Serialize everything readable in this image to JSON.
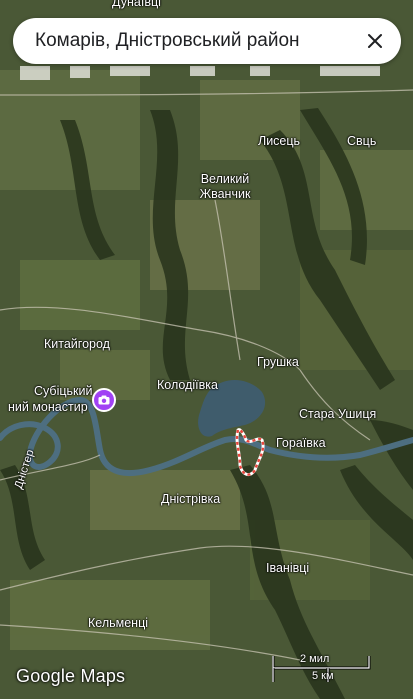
{
  "search": {
    "query": "Комарів, Дністровський район"
  },
  "icons": {
    "close": "close-icon",
    "pin": "camera-pin-icon"
  },
  "colors": {
    "river": "#4d6e80",
    "pin": "#a142f4",
    "boundary": "#e8453c"
  },
  "labels": {
    "dunaivtsi": "Дунаївці",
    "lysets": "Лисець",
    "svts": "Свць",
    "velykyi_zhvanchyk": "Великий Жванчик",
    "kytaihorod": "Китайгород",
    "hrushka": "Грушка",
    "kolodiivka": "Колодіївка",
    "subitskyi": "Субіцький",
    "monastyr": "ний монастир",
    "stara_ushytsia": "Стара Ушиця",
    "horaivka": "Гораївка",
    "dnister": "Дністер",
    "dnistrivka": "Дністрівка",
    "ivanivtsi": "Іванівці",
    "kelmentsi": "Кельменці"
  },
  "scale": {
    "miles": "2 мил",
    "km": "5 км"
  },
  "watermark": "Google Maps"
}
